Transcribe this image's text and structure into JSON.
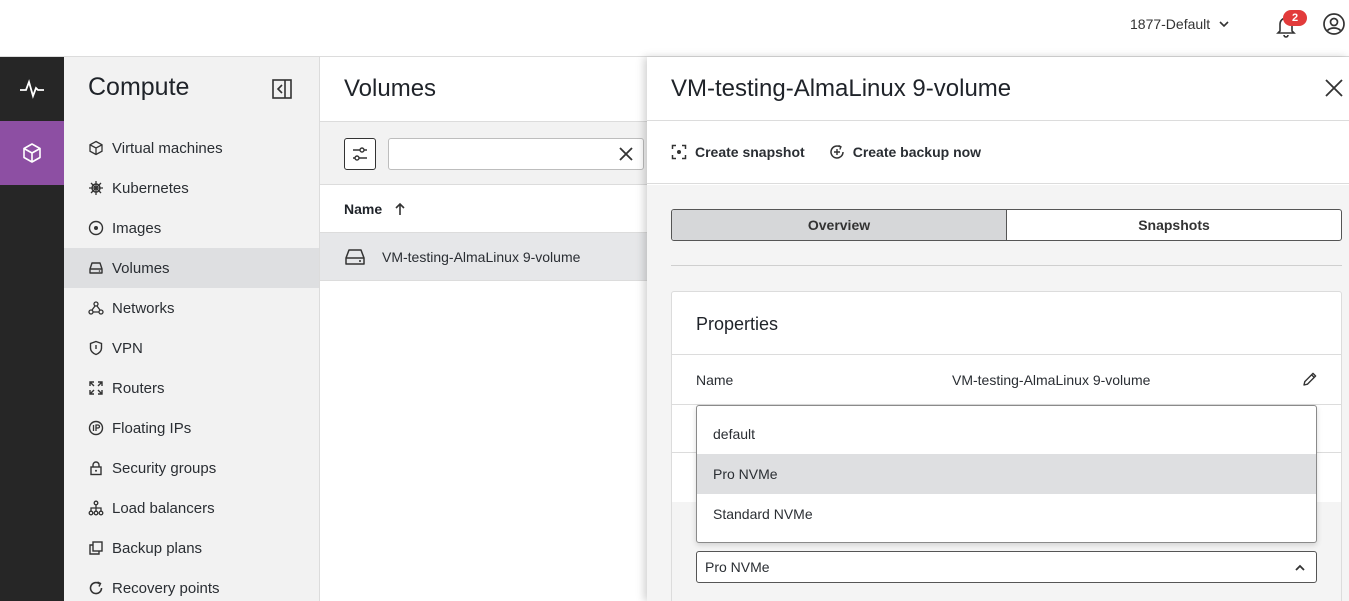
{
  "topbar": {
    "project": "1877-Default",
    "notification_count": "2"
  },
  "rail": {
    "items": [
      {
        "icon": "pulse-icon",
        "active": false
      },
      {
        "icon": "cube-icon",
        "active": true
      }
    ]
  },
  "sidebar": {
    "title": "Compute",
    "items": [
      {
        "label": "Virtual machines",
        "icon": "cube-icon"
      },
      {
        "label": "Kubernetes",
        "icon": "helm-icon"
      },
      {
        "label": "Images",
        "icon": "disc-icon"
      },
      {
        "label": "Volumes",
        "icon": "drive-icon",
        "active": true
      },
      {
        "label": "Networks",
        "icon": "network-icon"
      },
      {
        "label": "VPN",
        "icon": "shield-icon"
      },
      {
        "label": "Routers",
        "icon": "router-icon"
      },
      {
        "label": "Floating IPs",
        "icon": "ip-icon"
      },
      {
        "label": "Security groups",
        "icon": "lock-icon"
      },
      {
        "label": "Load balancers",
        "icon": "hierarchy-icon"
      },
      {
        "label": "Backup plans",
        "icon": "copy-icon"
      },
      {
        "label": "Recovery points",
        "icon": "refresh-icon"
      }
    ]
  },
  "list": {
    "title": "Volumes",
    "search_value": "",
    "column_name": "Name",
    "rows": [
      {
        "name": "VM-testing-AlmaLinux 9-volume"
      }
    ]
  },
  "panel": {
    "title": "VM-testing-AlmaLinux 9-volume",
    "actions": {
      "create_snapshot": "Create snapshot",
      "create_backup": "Create backup now"
    },
    "tabs": [
      {
        "label": "Overview",
        "active": true
      },
      {
        "label": "Snapshots",
        "active": false
      }
    ],
    "properties": {
      "title": "Properties",
      "name_label": "Name",
      "name_value": "VM-testing-AlmaLinux 9-volume"
    },
    "storage_policy": {
      "selected": "Pro NVMe",
      "options": [
        "default",
        "Pro NVMe",
        "Standard NVMe"
      ]
    }
  }
}
